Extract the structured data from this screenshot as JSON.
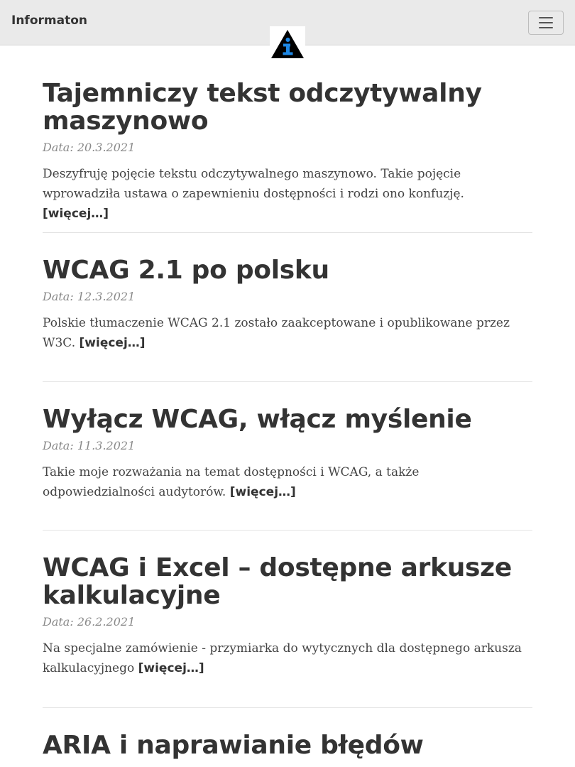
{
  "navbar": {
    "brand": "Informaton",
    "toggle_icon": "hamburger-menu-icon",
    "logo_icon": "info-triangle-logo-icon",
    "colors": {
      "background": "#eaeaea",
      "logo_triangle": "#000000",
      "logo_letter": "#1e88e5"
    }
  },
  "posts": [
    {
      "title": "Tajemniczy tekst odczytywalny maszynowo",
      "date": "Data: 20.3.2021",
      "excerpt": "Deszyfruję pojęcie tekstu odczytywalnego maszynowo. Takie pojęcie wprowadziła ustawa o zapewnieniu dostępności i rodzi ono konfuzję.",
      "more": "[więcej…]"
    },
    {
      "title": "WCAG 2.1 po polsku",
      "date": "Data: 12.3.2021",
      "excerpt": "Polskie tłumaczenie WCAG 2.1 zostało zaakceptowane i opublikowane przez W3C.",
      "more": "[więcej…]"
    },
    {
      "title": "Wyłącz WCAG, włącz myślenie",
      "date": "Data: 11.3.2021",
      "excerpt": "Takie moje rozważania na temat dostępności i WCAG, a także odpowiedzialności audytorów.",
      "more": "[więcej…]"
    },
    {
      "title": "WCAG i Excel – dostępne arkusze kalkulacyjne",
      "date": "Data: 26.2.2021",
      "excerpt": "Na specjalne zamówienie - przymiarka do wytycznych dla dostępnego arkusza kalkulacyjnego",
      "more": "[więcej…]"
    },
    {
      "title": "ARIA i naprawianie błędów",
      "date": "",
      "excerpt": "",
      "more": ""
    }
  ]
}
